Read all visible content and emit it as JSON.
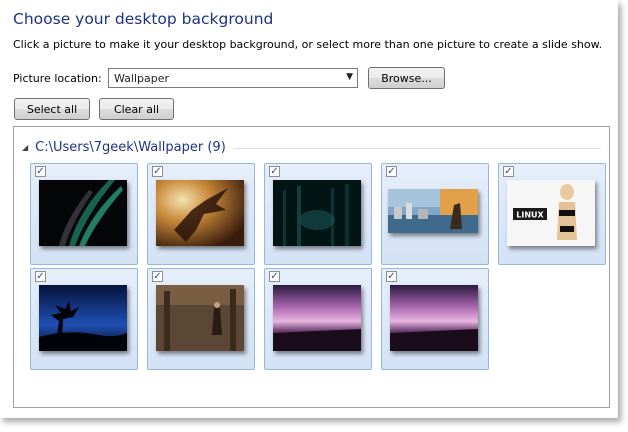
{
  "title": "Choose your desktop background",
  "description": "Click a picture to make it your desktop background, or select more than one picture to create a slide show.",
  "location": {
    "label": "Picture location:",
    "value": "Wallpaper",
    "browse_label": "Browse..."
  },
  "buttons": {
    "select_all": "Select all",
    "clear_all": "Clear all"
  },
  "group": {
    "name": "C:\\Users\\7geek\\Wallpaper (9)"
  },
  "wallpapers": [
    {
      "checked": true,
      "content": "abstract-dark-aurora"
    },
    {
      "checked": true,
      "content": "fantasy-warrior-art"
    },
    {
      "checked": true,
      "content": "dark-forest"
    },
    {
      "checked": true,
      "content": "city-coast-collage"
    },
    {
      "checked": true,
      "content": "linux-poster"
    },
    {
      "checked": true,
      "content": "blue-night-tree"
    },
    {
      "checked": true,
      "content": "dark-fantasy-interior"
    },
    {
      "checked": true,
      "content": "purple-storm-sky"
    },
    {
      "checked": true,
      "content": "purple-storm-sky"
    }
  ],
  "colors": {
    "title": "#1e3287",
    "tile_border": "#94b8e0",
    "tile_fill": "#dce8f7"
  }
}
